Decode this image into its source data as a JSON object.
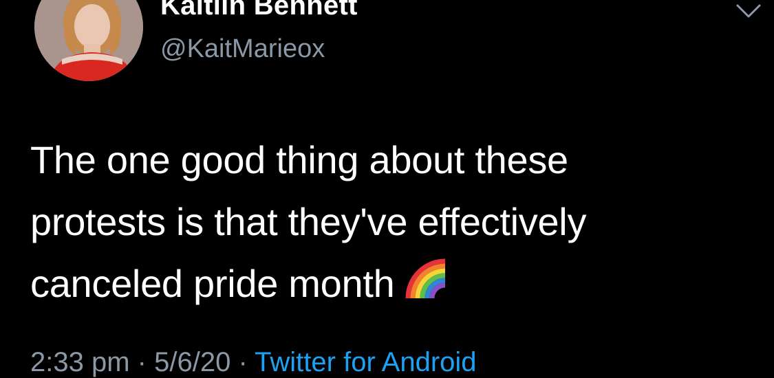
{
  "tweet": {
    "author": {
      "display_name": "Kaitlin Bennett",
      "handle": "@KaitMarieox",
      "avatar_icon": "profile-avatar"
    },
    "menu_icon": "chevron-down-icon",
    "text_lines": [
      "The one good thing about these",
      "protests is that they've effectively",
      "canceled pride month"
    ],
    "emoji": "rainbow-emoji",
    "meta": {
      "time": "2:33 pm",
      "separator": "·",
      "date": "5/6/20",
      "source": "Twitter for Android"
    },
    "colors": {
      "background": "#000000",
      "text": "#ffffff",
      "secondary": "#8b98a5",
      "link": "#1da1f2"
    }
  }
}
